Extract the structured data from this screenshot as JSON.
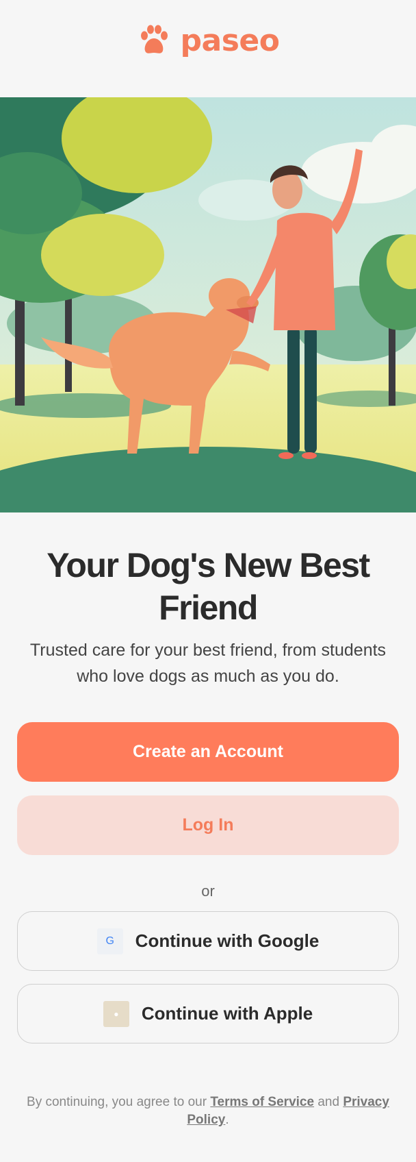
{
  "app": {
    "name": "paseo",
    "logo_icon": "paw-icon",
    "accent": "#ff7c5b"
  },
  "hero": {
    "illustration": "woman-playing-with-golden-retriever-in-park"
  },
  "headline": "Your Dog's New Best Friend",
  "subtitle": "Trusted care for your best friend, from students who love dogs as much as you do.",
  "actions": {
    "create_account": "Create an Account",
    "log_in": "Log In",
    "divider": "or",
    "google": "Continue with Google",
    "google_icon": "G",
    "apple": "Continue with Apple"
  },
  "legal": {
    "prefix": "By continuing, you agree to our",
    "terms": "Terms of Service",
    "and": "and",
    "privacy": "Privacy Policy",
    "suffix": "."
  }
}
